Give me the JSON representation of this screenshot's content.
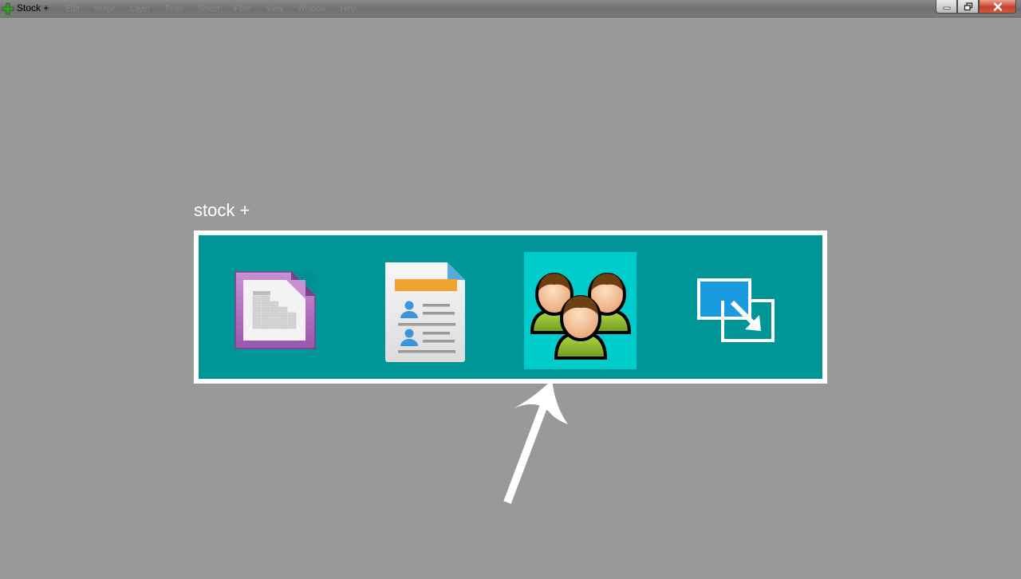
{
  "window": {
    "title": "Stock +",
    "menu": [
      "Edit",
      "Image",
      "Layer",
      "Tools",
      "Select",
      "Filter",
      "View",
      "Window",
      "Help"
    ],
    "controls": {
      "minimize_icon": "minimize-icon",
      "maximize_icon": "restore-icon",
      "close_icon": "close-icon"
    }
  },
  "main": {
    "section_label": "stock +",
    "tiles": [
      {
        "icon": "spreadsheet-icon",
        "selected": false
      },
      {
        "icon": "contacts-document-icon",
        "selected": false
      },
      {
        "icon": "users-group-icon",
        "selected": true
      },
      {
        "icon": "transfer-window-icon",
        "selected": false
      }
    ]
  },
  "colors": {
    "background": "#999999",
    "panel": "#009597",
    "panel_border": "#ffffff",
    "selected_tile": "#00cccc"
  }
}
